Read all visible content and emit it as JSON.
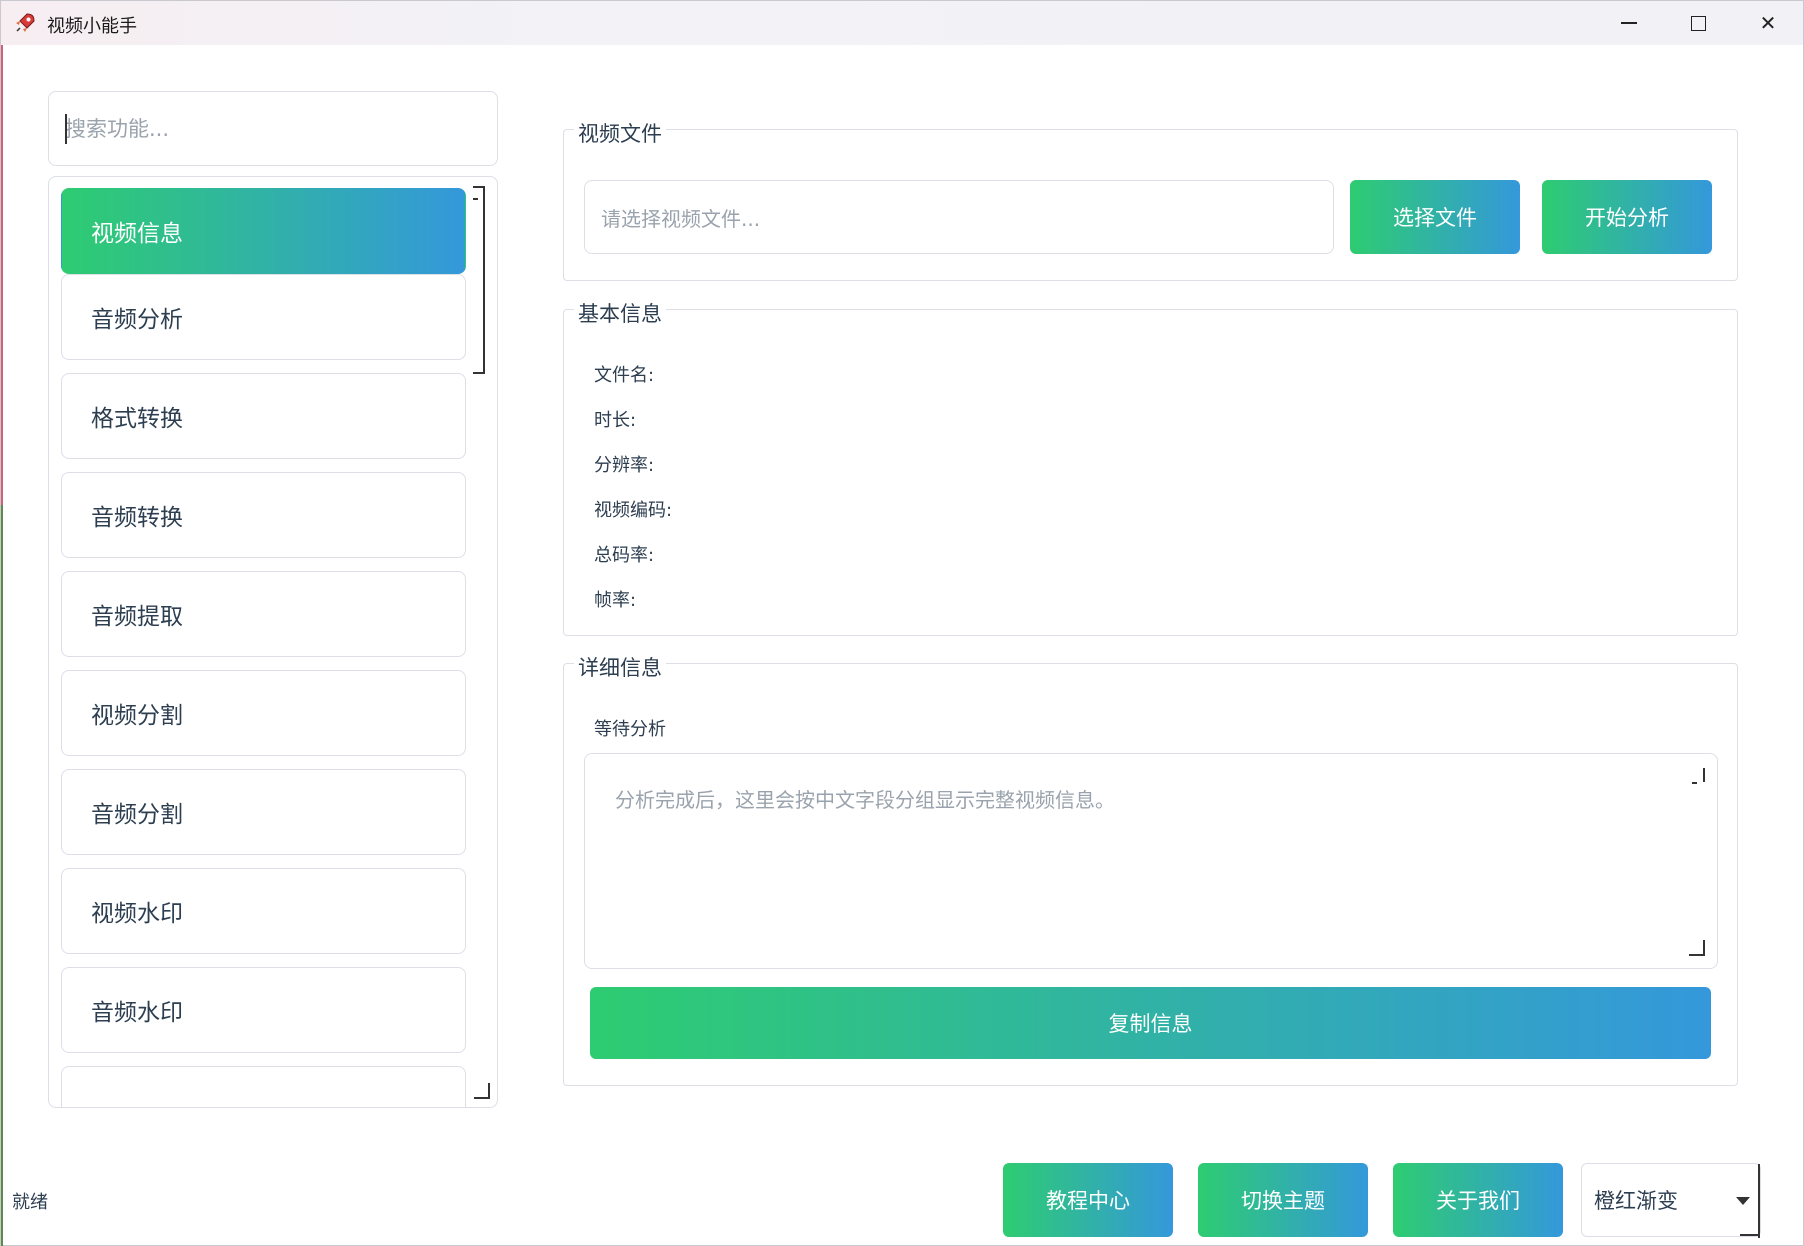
{
  "window": {
    "title": "视频小能手",
    "icon": "rocket-app-icon",
    "minimize_icon": "minimize-icon",
    "maximize_icon": "maximize-icon",
    "close_icon": "close-icon",
    "close_glyph": "✕"
  },
  "sidebar": {
    "search_placeholder": "搜索功能...",
    "items": [
      {
        "label": "视频信息",
        "active": true
      },
      {
        "label": "音频分析",
        "active": false
      },
      {
        "label": "格式转换",
        "active": false
      },
      {
        "label": "音频转换",
        "active": false
      },
      {
        "label": "音频提取",
        "active": false
      },
      {
        "label": "视频分割",
        "active": false
      },
      {
        "label": "音频分割",
        "active": false
      },
      {
        "label": "视频水印",
        "active": false
      },
      {
        "label": "音频水印",
        "active": false
      }
    ]
  },
  "video_file": {
    "group_title": "视频文件",
    "placeholder": "请选择视频文件...",
    "select_button": "选择文件",
    "analyze_button": "开始分析"
  },
  "basic_info": {
    "group_title": "基本信息",
    "fields": [
      "文件名:",
      "时长:",
      "分辨率:",
      "视频编码:",
      "总码率:",
      "帧率:"
    ]
  },
  "detail_info": {
    "group_title": "详细信息",
    "status": "等待分析",
    "placeholder": "分析完成后，这里会按中文字段分组显示完整视频信息。",
    "copy_button": "复制信息"
  },
  "footer": {
    "status": "就绪",
    "tutorial_button": "教程中心",
    "theme_button": "切换主题",
    "about_button": "关于我们",
    "theme_select_value": "橙红渐变"
  },
  "colors": {
    "gradient_start": "#2ecc71",
    "gradient_end": "#3498db",
    "border": "#dcdfe6",
    "text": "#2c3e50",
    "placeholder": "#9aa3ad"
  }
}
